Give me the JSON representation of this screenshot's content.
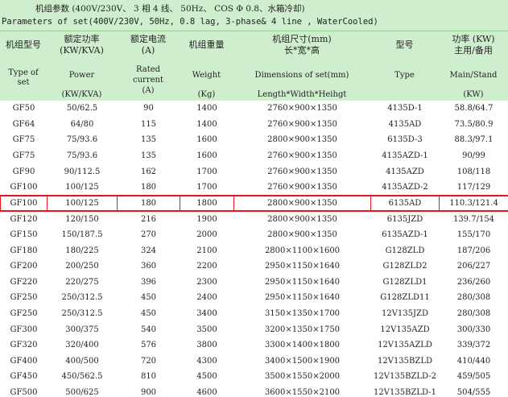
{
  "title": {
    "cn": "机组参数 (400V/230V、 3 相 4 线、 50Hz、 COS Φ 0.8、水箱冷却)",
    "en": "Parameters of set(400V/230V, 50Hz, 0.8 lag, 3-phase& 4 line , WaterCooled)"
  },
  "headers": [
    {
      "cn": [
        "机组型号"
      ],
      "en": [
        "Type of",
        "set"
      ]
    },
    {
      "cn": [
        "额定功率",
        "(KW/KVA)"
      ],
      "en": [
        "Power",
        "",
        "(KW/KVA)"
      ]
    },
    {
      "cn": [
        "额定电流",
        "(A)"
      ],
      "en": [
        "Rated",
        "current",
        "(A)"
      ]
    },
    {
      "cn": [
        "机组重量"
      ],
      "en": [
        "Weight",
        "",
        "(Kg)"
      ]
    },
    {
      "cn": [
        "机组尺寸(mm)",
        "长*宽*高"
      ],
      "en": [
        "Dimensions of set(mm)",
        "",
        "Length*Width*Heihgt"
      ]
    },
    {
      "cn": [
        "型号"
      ],
      "en": [
        "Type"
      ]
    },
    {
      "cn": [
        "功率 (KW)",
        "主用/备用"
      ],
      "en": [
        "Main/Stand",
        "",
        "(KW)"
      ]
    }
  ],
  "rows": [
    [
      "GF50",
      "50/62.5",
      "90",
      "1400",
      "2760×900×1350",
      "4135D-1",
      "58.8/64.7"
    ],
    [
      "GF64",
      "64/80",
      "115",
      "1400",
      "2760×900×1350",
      "4135AD",
      "73.5/80.9"
    ],
    [
      "GF75",
      "75/93.6",
      "135",
      "1600",
      "2800×900×1350",
      "6135D-3",
      "88.3/97.1"
    ],
    [
      "GF75",
      "75/93.6",
      "135",
      "1600",
      "2760×900×1350",
      "4135AZD-1",
      "90/99"
    ],
    [
      "GF90",
      "90/112.5",
      "162",
      "1700",
      "2760×900×1350",
      "4135AZD",
      "108/118"
    ],
    [
      "GF100",
      "100/125",
      "180",
      "1700",
      "2760×900×1350",
      "4135AZD-2",
      "117/129"
    ],
    [
      "GF100",
      "100/125",
      "180",
      "1800",
      "2800×900×1350",
      "6135AD",
      "110.3/121.4"
    ],
    [
      "GF120",
      "120/150",
      "216",
      "1900",
      "2800×900×1350",
      "6135JZD",
      "139.7/154"
    ],
    [
      "GF150",
      "150/187.5",
      "270",
      "2000",
      "2800×900×1350",
      "6135AZD-1",
      "155/170"
    ],
    [
      "GF180",
      "180/225",
      "324",
      "2100",
      "2800×1100×1600",
      "G128ZLD",
      "187/206"
    ],
    [
      "GF200",
      "200/250",
      "360",
      "2200",
      "2950×1150×1640",
      "G128ZLD2",
      "206/227"
    ],
    [
      "GF220",
      "220/275",
      "396",
      "2300",
      "2950×1150×1640",
      "G128ZLD1",
      "236/260"
    ],
    [
      "GF250",
      "250/312.5",
      "450",
      "2400",
      "2950×1150×1640",
      "G128ZLD11",
      "280/308"
    ],
    [
      "GF250",
      "250/312.5",
      "450",
      "3400",
      "3150×1350×1700",
      "12V135JZD",
      "280/308"
    ],
    [
      "GF300",
      "300/375",
      "540",
      "3500",
      "3200×1350×1750",
      "12V135AZD",
      "300/330"
    ],
    [
      "GF320",
      "320/400",
      "576",
      "3800",
      "3300×1400×1800",
      "12V135AZLD",
      "339/372"
    ],
    [
      "GF400",
      "400/500",
      "720",
      "4300",
      "3400×1500×1900",
      "12V135BZLD",
      "410/440"
    ],
    [
      "GF450",
      "450/562.5",
      "810",
      "4500",
      "3500×1550×2000",
      "12V135BZLD-2",
      "459/505"
    ],
    [
      "GF500",
      "500/625",
      "900",
      "4600",
      "3600×1550×2100",
      "12V135BZLD-1",
      "504/555"
    ]
  ],
  "highlight_row": 6,
  "colors": {
    "header_bg": "#cfeece",
    "highlight_border": "#e8141c"
  }
}
